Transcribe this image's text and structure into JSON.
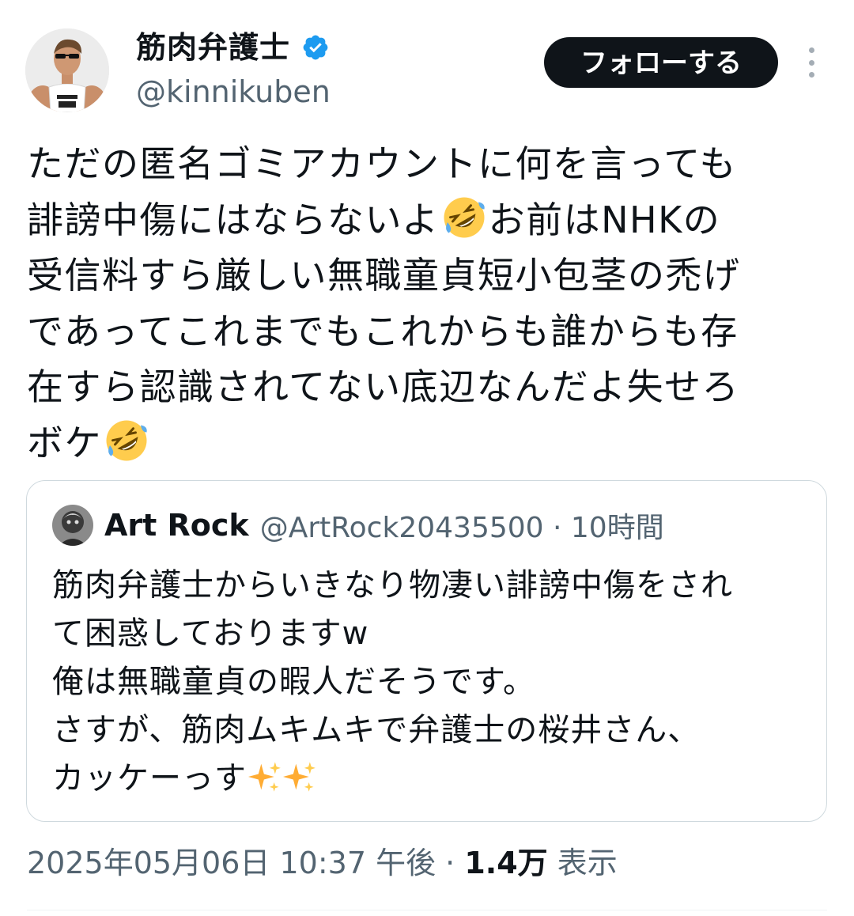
{
  "author": {
    "display_name": "筋肉弁護士",
    "handle": "@kinnikuben",
    "verified_icon": "verified-badge-icon",
    "verified_color": "#1d9bf0"
  },
  "follow_button": {
    "label": "フォローする"
  },
  "more_icon": "more-vertical-icon",
  "tweet": {
    "lines": [
      "ただの匿名ゴミアカウントに何を言っても",
      "誹謗中傷にはならないよ",
      "お前はNHKの",
      "受信料すら厳しい無職童貞短小包茎の禿げ",
      "であってこれまでもこれからも誰からも存",
      "在すら認識されてない底辺なんだよ失せろ",
      "ボケ"
    ],
    "emoji": "rolling-on-floor-laughing-emoji"
  },
  "quote": {
    "name": "Art Rock",
    "handle_time": "@ArtRock20435500 · 10時間",
    "lines": [
      "筋肉弁護士からいきなり物凄い誹謗中傷をされ",
      "て困惑しておりますw",
      "俺は無職童貞の暇人だそうです。",
      "さすが、筋肉ムキムキで弁護士の桜井さん、",
      "カッケーっす"
    ],
    "emoji": "sparkles-emoji"
  },
  "meta": {
    "timestamp": "2025年05月06日 10:37 午後 · ",
    "views_count": "1.4万",
    "views_label": "表示"
  },
  "colors": {
    "text_primary": "#0f1419",
    "text_secondary": "#536471",
    "border": "#cfd9de",
    "follow_bg": "#0f1419"
  }
}
